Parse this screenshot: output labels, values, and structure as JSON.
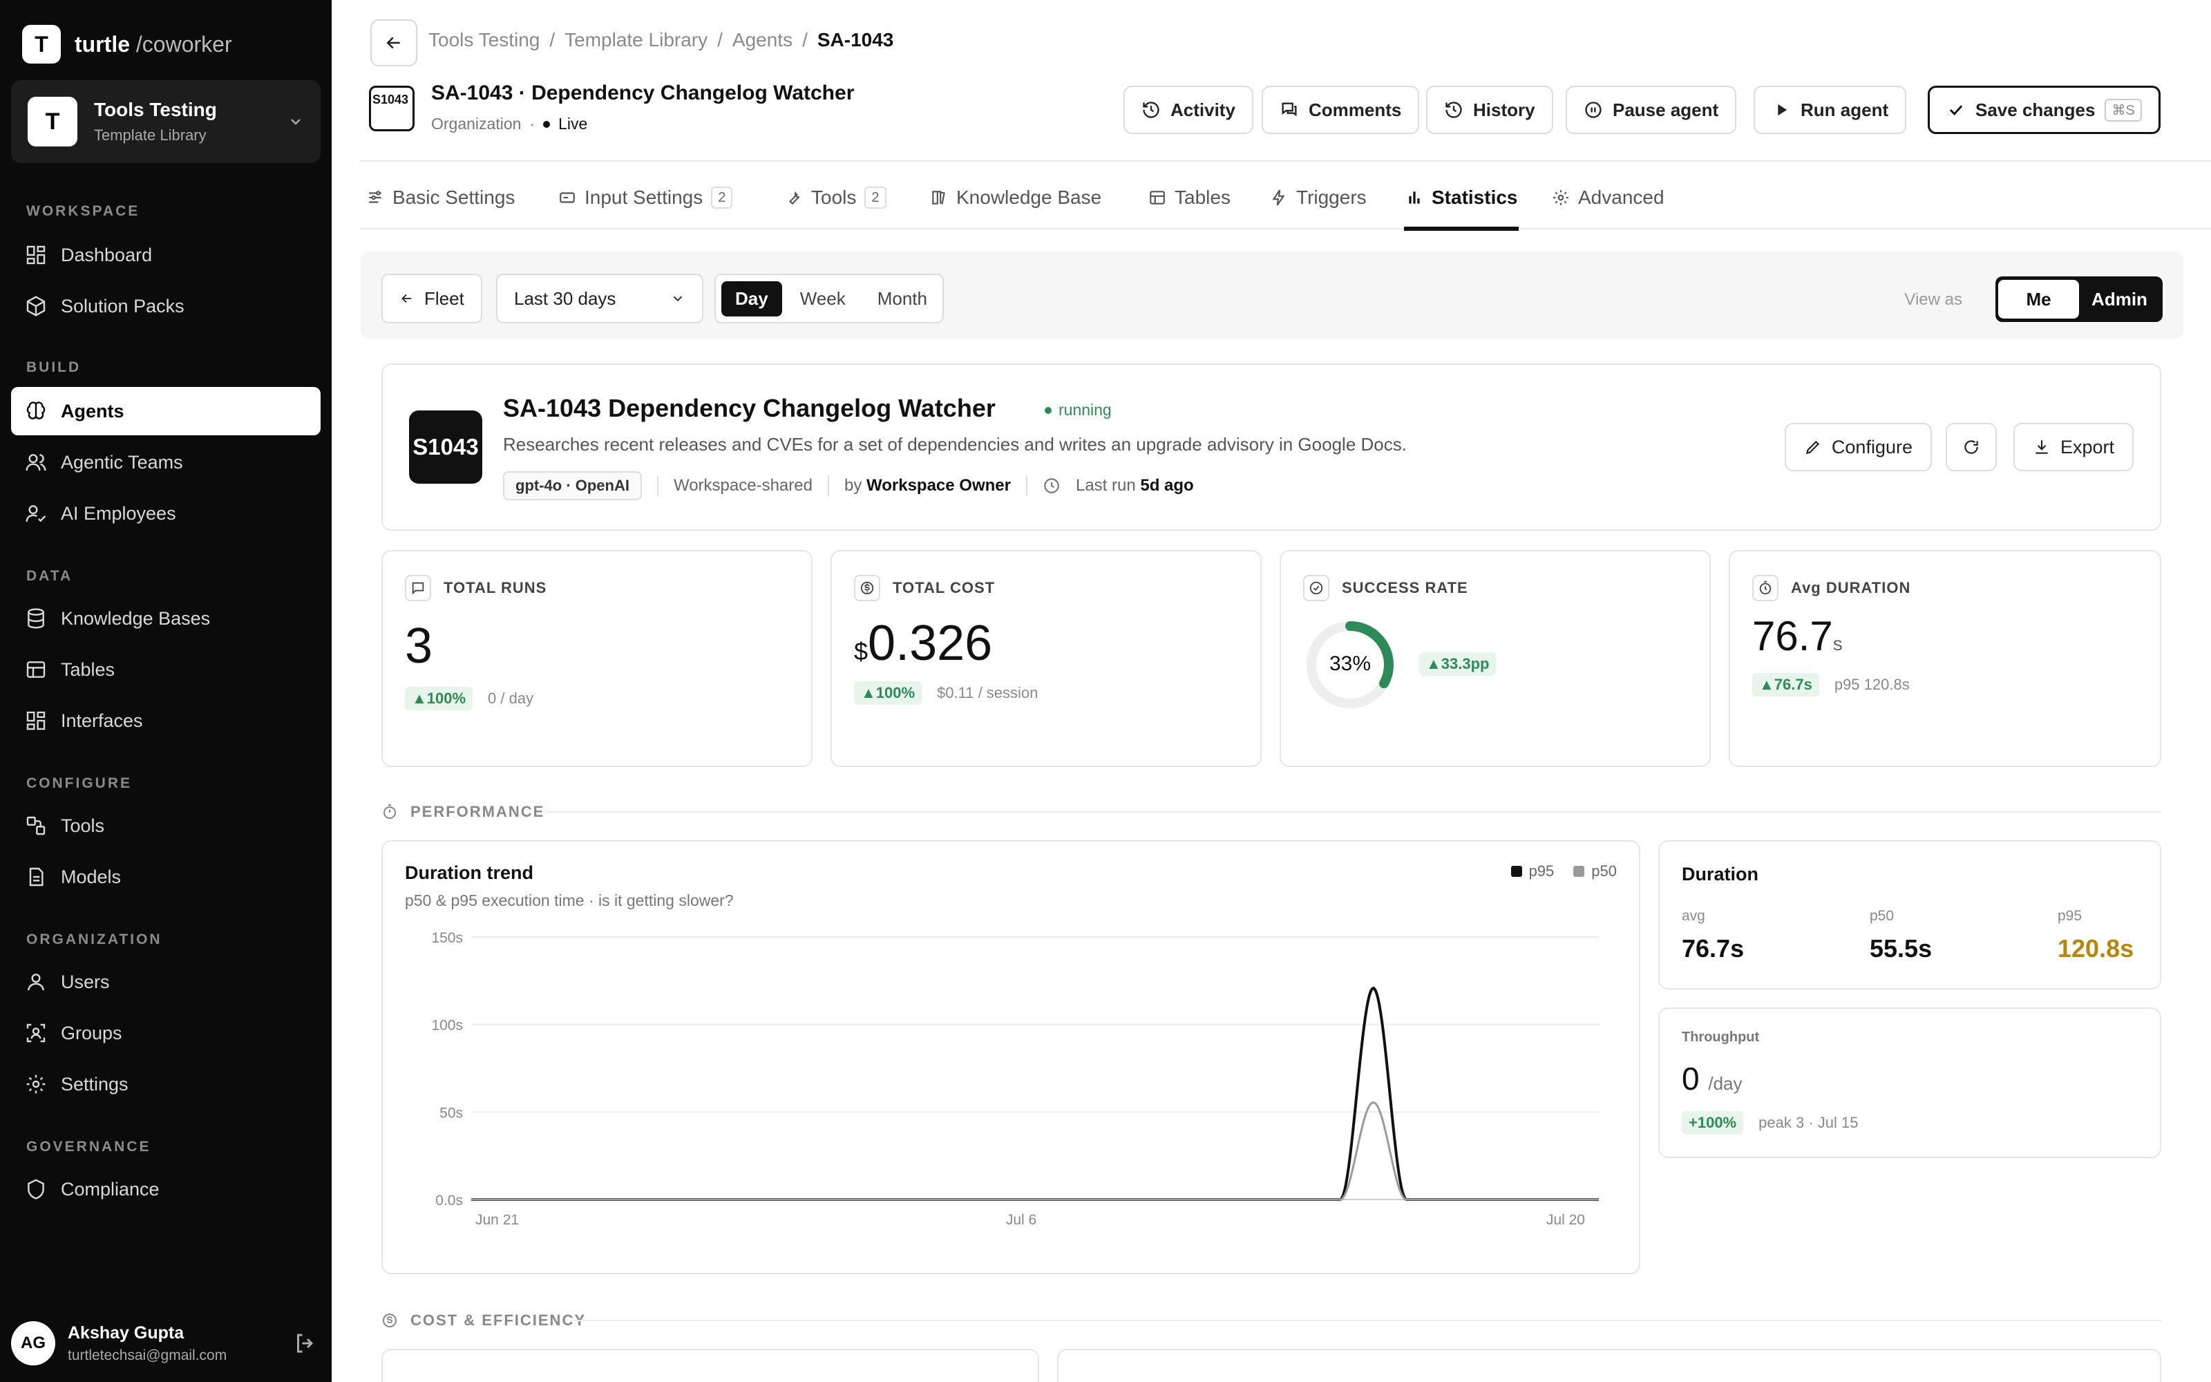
{
  "brand": {
    "mark": "T",
    "name": "turtle",
    "suffix": "/coworker"
  },
  "workspace": {
    "avatar": "T",
    "name": "Tools Testing",
    "sub": "Template Library"
  },
  "sidebar": {
    "sections": [
      "WORKSPACE",
      "BUILD",
      "DATA",
      "CONFIGURE",
      "ORGANIZATION",
      "GOVERNANCE"
    ],
    "items": [
      {
        "label": "Dashboard",
        "icon": "dashboard-icon"
      },
      {
        "label": "Solution Packs",
        "icon": "package-icon"
      },
      {
        "label": "Agents",
        "icon": "brain-icon",
        "active": true
      },
      {
        "label": "Agentic Teams",
        "icon": "team-icon"
      },
      {
        "label": "AI Employees",
        "icon": "user-check-icon"
      },
      {
        "label": "Knowledge Bases",
        "icon": "database-icon"
      },
      {
        "label": "Tables",
        "icon": "table-icon"
      },
      {
        "label": "Interfaces",
        "icon": "layout-icon"
      },
      {
        "label": "Tools",
        "icon": "tools-icon"
      },
      {
        "label": "Models",
        "icon": "model-icon"
      },
      {
        "label": "Users",
        "icon": "user-icon"
      },
      {
        "label": "Groups",
        "icon": "groups-icon"
      },
      {
        "label": "Settings",
        "icon": "gear-icon"
      },
      {
        "label": "Compliance",
        "icon": "shield-icon"
      }
    ]
  },
  "user": {
    "initials": "AG",
    "name": "Akshay Gupta",
    "email": "turtletechsai@gmail.com"
  },
  "breadcrumb": [
    "Tools Testing",
    "/",
    "Template Library",
    "/",
    "Agents",
    "/",
    "SA-1043"
  ],
  "agent": {
    "icon_text": "S1043",
    "title": "SA-1043 · Dependency Changelog Watcher",
    "scope": "Organization",
    "sep": "·",
    "live": "Live"
  },
  "header_buttons": {
    "activity": "Activity",
    "comments": "Comments",
    "history": "History",
    "pause": "Pause agent",
    "run": "Run agent",
    "save": "Save changes",
    "save_kbd": "⌘S"
  },
  "tabs": [
    {
      "label": "Basic Settings"
    },
    {
      "label": "Input Settings",
      "badge": "2"
    },
    {
      "label": "Tools",
      "badge": "2"
    },
    {
      "label": "Knowledge Base"
    },
    {
      "label": "Tables"
    },
    {
      "label": "Triggers"
    },
    {
      "label": "Statistics",
      "active": true
    },
    {
      "label": "Advanced"
    }
  ],
  "toolbar": {
    "fleet": "Fleet",
    "range": "Last 30 days",
    "granularity": [
      "Day",
      "Week",
      "Month"
    ],
    "selected_granularity": "Day",
    "view_as_label": "View as",
    "view_as": [
      "Me",
      "Admin"
    ],
    "selected_view": "Me"
  },
  "agent_card": {
    "logo": "S1043",
    "title": "SA-1043 Dependency Changelog Watcher",
    "status": "running",
    "description": "Researches recent releases and CVEs for a set of dependencies and writes an upgrade advisory in Google Docs.",
    "model": "gpt-4o · OpenAI",
    "sharing": "Workspace-shared",
    "by_label": "by",
    "owner": "Workspace Owner",
    "last_run_label": "Last run",
    "last_run": "5d ago",
    "configure": "Configure",
    "export": "Export"
  },
  "kpis": {
    "total_runs": {
      "label": "TOTAL RUNS",
      "value": "3",
      "delta": "▲100%",
      "sub": "0 / day"
    },
    "total_cost": {
      "label": "TOTAL COST",
      "currency": "$",
      "value": "0.326",
      "delta": "▲100%",
      "sub": "$0.11 / session"
    },
    "success_rate": {
      "label": "SUCCESS RATE",
      "value": "33%",
      "fraction": 0.33,
      "delta": "▲33.3pp"
    },
    "avg_duration": {
      "label": "Avg DURATION",
      "value": "76.7",
      "unit": "s",
      "delta": "▲76.7s",
      "sub": "p95 120.8s"
    }
  },
  "sections": {
    "performance": "PERFORMANCE",
    "cost": "COST & EFFICIENCY"
  },
  "chart_data": {
    "type": "area",
    "title": "Duration trend",
    "subtitle": "p50 & p95 execution time · is it getting slower?",
    "x_ticks": [
      "Jun 21",
      "Jul 6",
      "Jul 20"
    ],
    "y_ticks": [
      "150s",
      "100s",
      "50s",
      "0.0s"
    ],
    "ylim": [
      0,
      150
    ],
    "x_start": "Jun 21",
    "x_end": "Jul 21",
    "peak_date": "Jul 15",
    "series": [
      {
        "name": "p95",
        "color": "#111111",
        "peak": 120.8
      },
      {
        "name": "p50",
        "color": "#9a9a9a",
        "peak": 55.5
      }
    ]
  },
  "duration": {
    "title": "Duration",
    "avg_label": "avg",
    "avg": "76.7s",
    "p50_label": "p50",
    "p50": "55.5s",
    "p95_label": "p95",
    "p95": "120.8s",
    "p95_color": "#b8860b"
  },
  "throughput": {
    "label": "Throughput",
    "value": "0",
    "unit": "/day",
    "delta": "+100%",
    "sub": "peak 3 · Jul 15"
  }
}
